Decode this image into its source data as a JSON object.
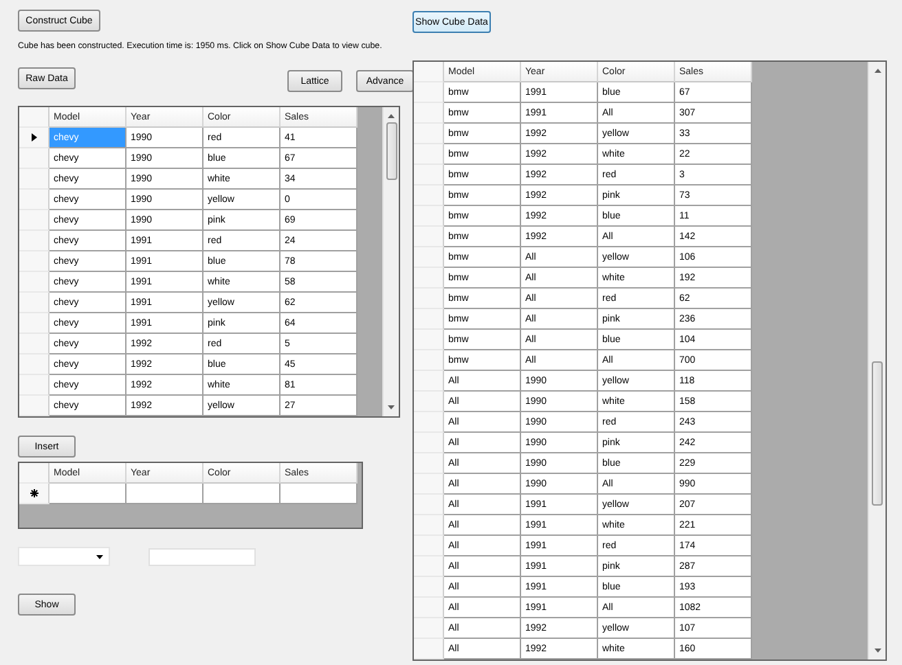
{
  "construct_button": "Construct Cube",
  "status_message": "Cube has been constructed. Execution time is: 1950 ms. Click on Show Cube Data to view cube.",
  "raw_data_button": "Raw Data",
  "lattice_button": "Lattice",
  "advance_button": "Advance",
  "raw_table": {
    "columns": [
      "Model",
      "Year",
      "Color",
      "Sales"
    ],
    "rows": [
      {
        "cells": [
          "chevy",
          "1990",
          "red",
          "41"
        ],
        "selected": true
      },
      {
        "cells": [
          "chevy",
          "1990",
          "blue",
          "67"
        ],
        "selected": false
      },
      {
        "cells": [
          "chevy",
          "1990",
          "white",
          "34"
        ],
        "selected": false
      },
      {
        "cells": [
          "chevy",
          "1990",
          "yellow",
          "0"
        ],
        "selected": false
      },
      {
        "cells": [
          "chevy",
          "1990",
          "pink",
          "69"
        ],
        "selected": false
      },
      {
        "cells": [
          "chevy",
          "1991",
          "red",
          "24"
        ],
        "selected": false
      },
      {
        "cells": [
          "chevy",
          "1991",
          "blue",
          "78"
        ],
        "selected": false
      },
      {
        "cells": [
          "chevy",
          "1991",
          "white",
          "58"
        ],
        "selected": false
      },
      {
        "cells": [
          "chevy",
          "1991",
          "yellow",
          "62"
        ],
        "selected": false
      },
      {
        "cells": [
          "chevy",
          "1991",
          "pink",
          "64"
        ],
        "selected": false
      },
      {
        "cells": [
          "chevy",
          "1992",
          "red",
          "5"
        ],
        "selected": false
      },
      {
        "cells": [
          "chevy",
          "1992",
          "blue",
          "45"
        ],
        "selected": false
      },
      {
        "cells": [
          "chevy",
          "1992",
          "white",
          "81"
        ],
        "selected": false
      },
      {
        "cells": [
          "chevy",
          "1992",
          "yellow",
          "27"
        ],
        "selected": false
      }
    ]
  },
  "insert_button": "Insert",
  "insert_table": {
    "columns": [
      "Model",
      "Year",
      "Color",
      "Sales"
    ]
  },
  "show_button": "Show",
  "show_cube_button": "Show Cube Data",
  "cube_table": {
    "columns": [
      "Model",
      "Year",
      "Color",
      "Sales"
    ],
    "rows": [
      [
        "bmw",
        "1991",
        "blue",
        "67"
      ],
      [
        "bmw",
        "1991",
        "All",
        "307"
      ],
      [
        "bmw",
        "1992",
        "yellow",
        "33"
      ],
      [
        "bmw",
        "1992",
        "white",
        "22"
      ],
      [
        "bmw",
        "1992",
        "red",
        "3"
      ],
      [
        "bmw",
        "1992",
        "pink",
        "73"
      ],
      [
        "bmw",
        "1992",
        "blue",
        "11"
      ],
      [
        "bmw",
        "1992",
        "All",
        "142"
      ],
      [
        "bmw",
        "All",
        "yellow",
        "106"
      ],
      [
        "bmw",
        "All",
        "white",
        "192"
      ],
      [
        "bmw",
        "All",
        "red",
        "62"
      ],
      [
        "bmw",
        "All",
        "pink",
        "236"
      ],
      [
        "bmw",
        "All",
        "blue",
        "104"
      ],
      [
        "bmw",
        "All",
        "All",
        "700"
      ],
      [
        "All",
        "1990",
        "yellow",
        "118"
      ],
      [
        "All",
        "1990",
        "white",
        "158"
      ],
      [
        "All",
        "1990",
        "red",
        "243"
      ],
      [
        "All",
        "1990",
        "pink",
        "242"
      ],
      [
        "All",
        "1990",
        "blue",
        "229"
      ],
      [
        "All",
        "1990",
        "All",
        "990"
      ],
      [
        "All",
        "1991",
        "yellow",
        "207"
      ],
      [
        "All",
        "1991",
        "white",
        "221"
      ],
      [
        "All",
        "1991",
        "red",
        "174"
      ],
      [
        "All",
        "1991",
        "pink",
        "287"
      ],
      [
        "All",
        "1991",
        "blue",
        "193"
      ],
      [
        "All",
        "1991",
        "All",
        "1082"
      ],
      [
        "All",
        "1992",
        "yellow",
        "107"
      ],
      [
        "All",
        "1992",
        "white",
        "160"
      ]
    ]
  }
}
